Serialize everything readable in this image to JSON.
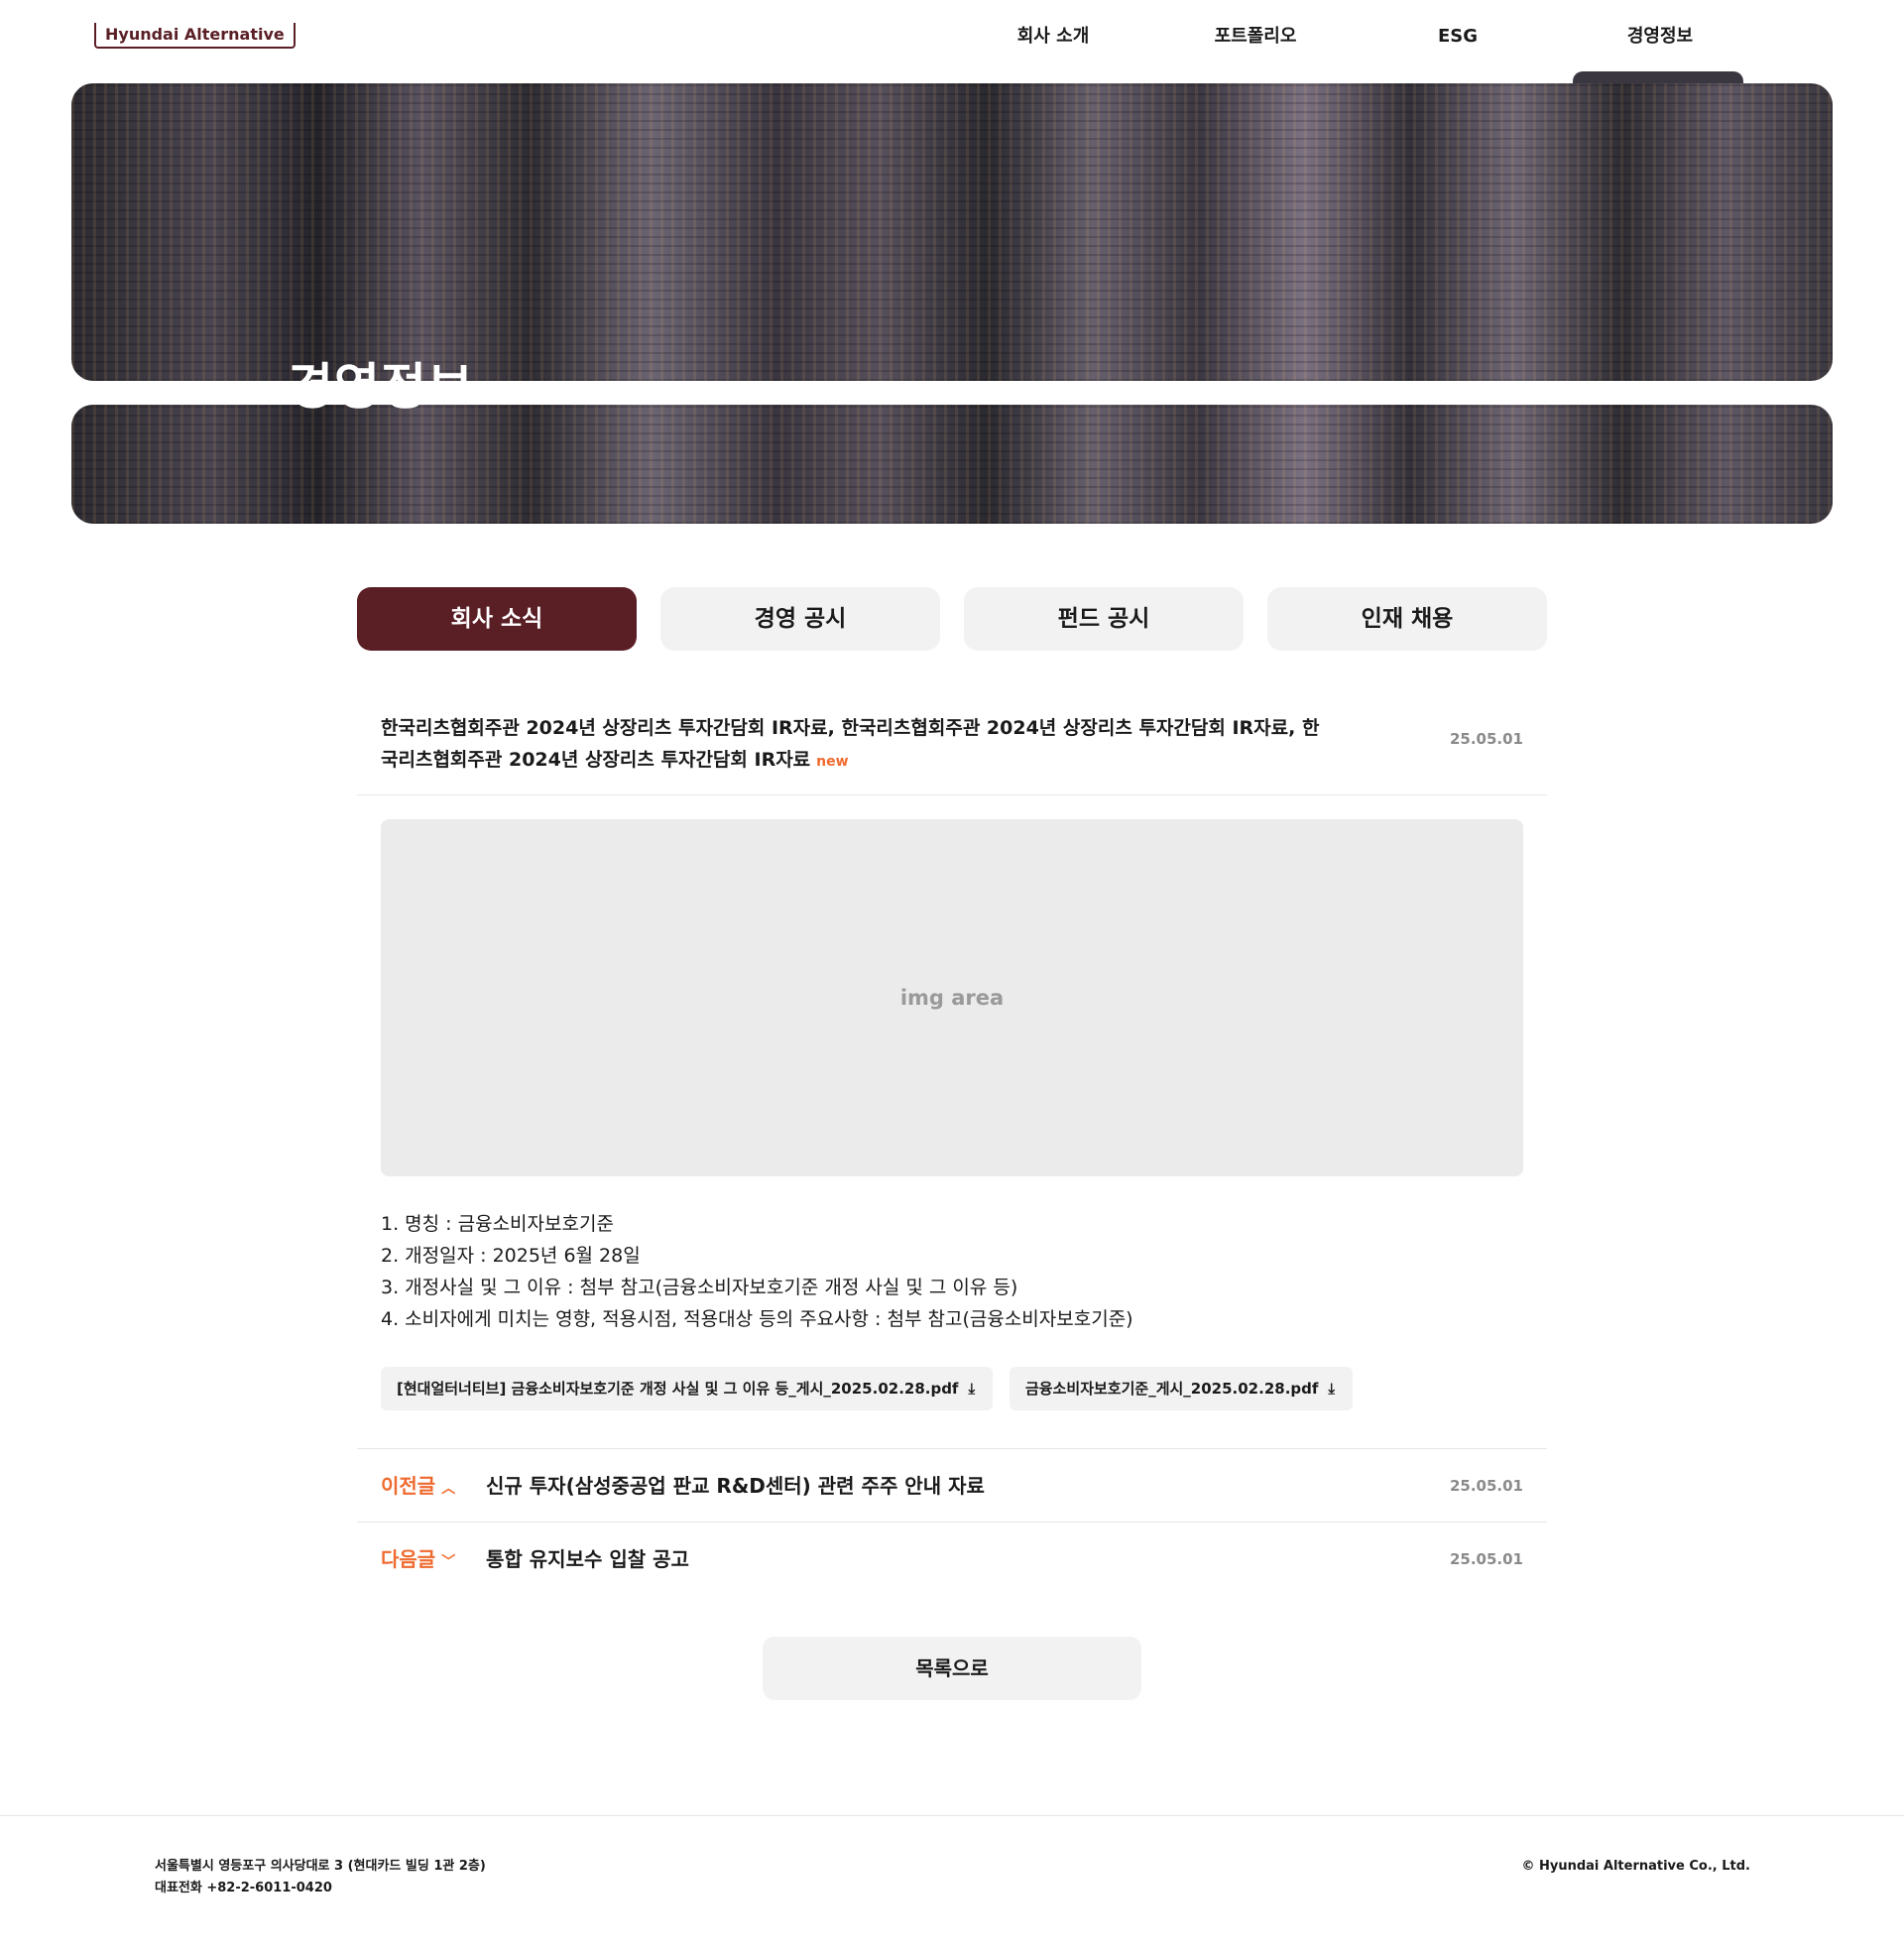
{
  "header": {
    "logo": "Hyundai Alternative",
    "nav": [
      "회사 소개",
      "포트폴리오",
      "ESG",
      "경영정보"
    ]
  },
  "hero": {
    "title": "경영정보"
  },
  "tabs": [
    "회사 소식",
    "경영 공시",
    "펀드 공시",
    "인재 채용"
  ],
  "article": {
    "title": "한국리츠협회주관 2024년 상장리츠 투자간담회 IR자료, 한국리츠협회주관 2024년 상장리츠 투자간담회 IR자료, 한국리츠협회주관 2024년 상장리츠 투자간담회 IR자료",
    "badge": "new",
    "date": "25.05.01",
    "image_placeholder": "img area",
    "lines": [
      "1. 명칭 : 금융소비자보호기준",
      "2. 개정일자 : 2025년 6월 28일",
      "3. 개정사실 및 그 이유 : 첨부 참고(금융소비자보호기준 개정 사실 및 그 이유 등)",
      "4. 소비자에게 미치는 영향, 적용시점, 적용대상 등의 주요사항 : 첨부 참고(금융소비자보호기준)"
    ],
    "attachments": [
      "[현대얼터너티브] 금융소비자보호기준 개정 사실 및 그 이유 등_게시_2025.02.28.pdf",
      "금융소비자보호기준_게시_2025.02.28.pdf"
    ]
  },
  "prev": {
    "label": "이전글",
    "title": "신규 투자(삼성중공업 판교 R&D센터) 관련 주주 안내 자료",
    "date": "25.05.01"
  },
  "next": {
    "label": "다음글",
    "title": "통합 유지보수 입찰 공고",
    "date": "25.05.01"
  },
  "list_button": "목록으로",
  "footer": {
    "address": "서울특별시 영등포구 의사당대로 3 (현대카드 빌딩 1관 2층)",
    "phone": "대표전화 +82-2-6011-0420",
    "copyright": "© Hyundai Alternative Co., Ltd."
  },
  "colors": {
    "brand": "#5a1e25",
    "accent": "#ef6a2e"
  },
  "icons": {
    "download": "download-icon",
    "chevron_up": "chevron-up-icon",
    "chevron_down": "chevron-down-icon"
  }
}
